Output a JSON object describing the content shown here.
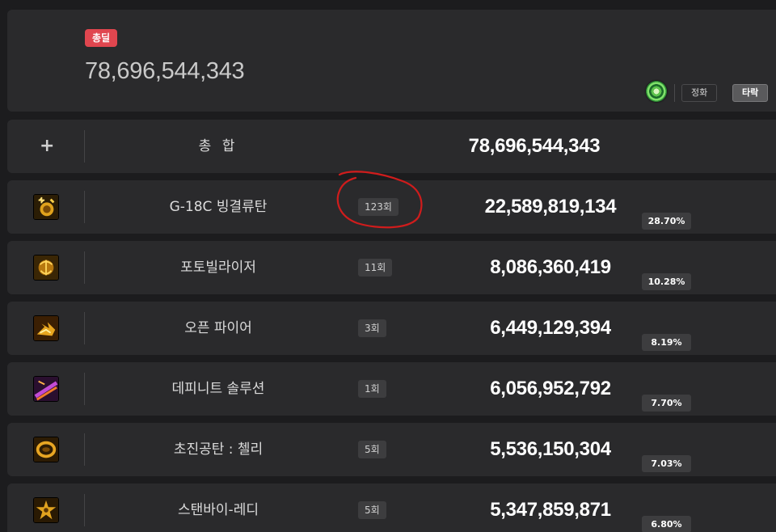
{
  "header": {
    "badge": "총딜",
    "total_value": "78,696,544,343",
    "tabs": [
      "정화",
      "타락"
    ],
    "active_tab": "타락",
    "icon": "green-spiral-icon"
  },
  "total_row": {
    "icon": "plus-icon",
    "label": "총 합",
    "damage": "78,696,544,343"
  },
  "skills": [
    {
      "icon": "bomb-skill-icon",
      "name": "G-18C 빙결류탄",
      "hits": "123회",
      "damage": "22,589,819,134",
      "percent": "28.70%",
      "percent_value": 28.7
    },
    {
      "icon": "photon-skill-icon",
      "name": "포토빌라이저",
      "hits": "11회",
      "damage": "8,086,360,419",
      "percent": "10.28%",
      "percent_value": 10.28
    },
    {
      "icon": "fire-skill-icon",
      "name": "오픈 파이어",
      "hits": "3회",
      "damage": "6,449,129,394",
      "percent": "8.19%",
      "percent_value": 8.19
    },
    {
      "icon": "purple-slash-skill-icon",
      "name": "데피니트 솔루션",
      "hits": "1회",
      "damage": "6,056,952,792",
      "percent": "7.70%",
      "percent_value": 7.7
    },
    {
      "icon": "ring-skill-icon",
      "name": "초진공탄 : 첼리",
      "hits": "5회",
      "damage": "5,536,150,304",
      "percent": "7.03%",
      "percent_value": 7.03
    },
    {
      "icon": "burst-skill-icon",
      "name": "스탠바이-레디",
      "hits": "5회",
      "damage": "5,347,859,871",
      "percent": "6.80%",
      "percent_value": 6.8
    }
  ],
  "colors": {
    "background": "#1c1c1e",
    "card": "#2a2a2c",
    "badge": "#e0464f",
    "annotation": "#d01c1c"
  }
}
